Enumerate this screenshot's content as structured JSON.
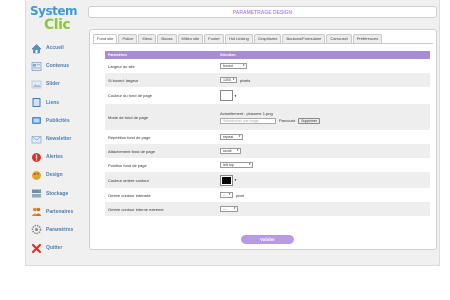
{
  "logo": {
    "line1": "System",
    "line2": "Clic"
  },
  "header": {
    "title": "PARAMETRAGE DESIGN"
  },
  "sidebar": {
    "items": [
      {
        "label": "Accueil",
        "icon": "home-icon",
        "color": "#5b8fc7"
      },
      {
        "label": "Contenus",
        "icon": "contents-icon",
        "color": "#7aa6cf"
      },
      {
        "label": "Slider",
        "icon": "slider-icon",
        "color": "#9fb9d6"
      },
      {
        "label": "Liens",
        "icon": "links-icon",
        "color": "#3d7fc0"
      },
      {
        "label": "Publicités",
        "icon": "ads-icon",
        "color": "#4a90d9"
      },
      {
        "label": "Newsletter",
        "icon": "newsletter-icon",
        "color": "#6aa0d2"
      },
      {
        "label": "Alertes",
        "icon": "alert-icon",
        "color": "#d9342b"
      },
      {
        "label": "Design",
        "icon": "design-icon",
        "color": "#f0a020"
      },
      {
        "label": "Stockage",
        "icon": "storage-icon",
        "color": "#6f8fb0"
      },
      {
        "label": "Partenaires",
        "icon": "partners-icon",
        "color": "#e08a2c"
      },
      {
        "label": "Paramètres",
        "icon": "settings-icon",
        "color": "#8a8a8a"
      },
      {
        "label": "Quitter",
        "icon": "quit-icon",
        "color": "#d9342b"
      }
    ]
  },
  "tabs": [
    {
      "label": "Fond site",
      "active": true
    },
    {
      "label": "Police"
    },
    {
      "label": "Menu"
    },
    {
      "label": "Bocas"
    },
    {
      "label": "Milieu site"
    },
    {
      "label": "Footer"
    },
    {
      "label": "Hot Linking"
    },
    {
      "label": "Graphisme"
    },
    {
      "label": "Boutons/Formulaire"
    },
    {
      "label": "Carrousel"
    },
    {
      "label": "Préférences"
    }
  ],
  "table": {
    "headers": [
      "Paramètres",
      "Sélection"
    ],
    "rows": [
      {
        "label": "Largeur du site",
        "value": "boxed"
      },
      {
        "label": "Si boxed: largeur",
        "value": "1300",
        "unit": "pixels"
      },
      {
        "label": "Couleur du fond de page",
        "color": "#ffffff"
      },
      {
        "label": "Mode de fond de page",
        "current": "Actuellement : plusome 1.png",
        "placeholder": "Sélectionner une image",
        "browse": "Parcourir",
        "delete": "Supprimer"
      },
      {
        "label": "Répétition fond de page",
        "value": "repeat"
      },
      {
        "label": "Attachement fond de page",
        "value": "scroll"
      },
      {
        "label": "Position fond de page",
        "value": "left top"
      },
      {
        "label": "Couleur ombre contour",
        "color": "#000000"
      },
      {
        "label": "Ombre contour intensité",
        "value": "--",
        "unit": "pixel"
      },
      {
        "label": "Ombre contour interne extreme",
        "value": "---"
      }
    ]
  },
  "footer": {
    "validate": "Valider"
  }
}
